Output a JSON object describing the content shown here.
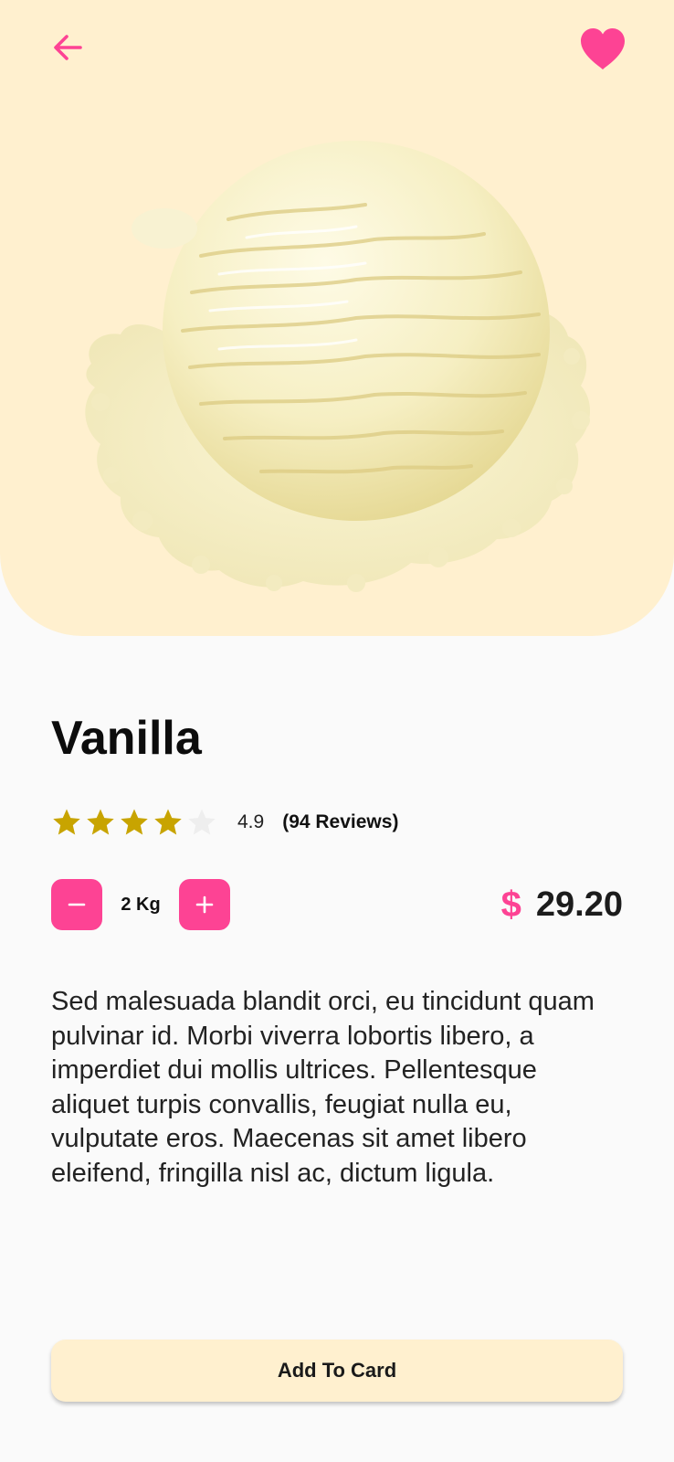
{
  "colors": {
    "accent": "#fd4394",
    "hero_background": "#fff0cf",
    "star_filled": "#c8a400",
    "star_empty": "#eeeeee",
    "page_background": "#fafafa"
  },
  "header": {
    "back_icon": "arrow-left-icon",
    "favorite_icon": "heart-icon",
    "favorite_active": true,
    "image": "vanilla-ice-cream-scoop"
  },
  "product": {
    "name": "Vanilla",
    "rating_stars_filled": 4,
    "rating_stars_total": 5,
    "rating_value": "4.9",
    "reviews_label": "(94 Reviews)",
    "quantity_label": "2 Kg",
    "decrement_icon": "minus-icon",
    "increment_icon": "plus-icon",
    "currency_symbol": "$",
    "price": "29.20",
    "description": "Sed malesuada blandit orci, eu tincidunt quam pulvinar id. Morbi viverra lobortis libero, a imperdiet dui mollis ultrices. Pellentesque aliquet turpis convallis, feugiat nulla eu, vulputate eros. Maecenas sit amet libero eleifend, fringilla nisl ac, dictum ligula."
  },
  "actions": {
    "add_to_cart_label": "Add To Card"
  }
}
